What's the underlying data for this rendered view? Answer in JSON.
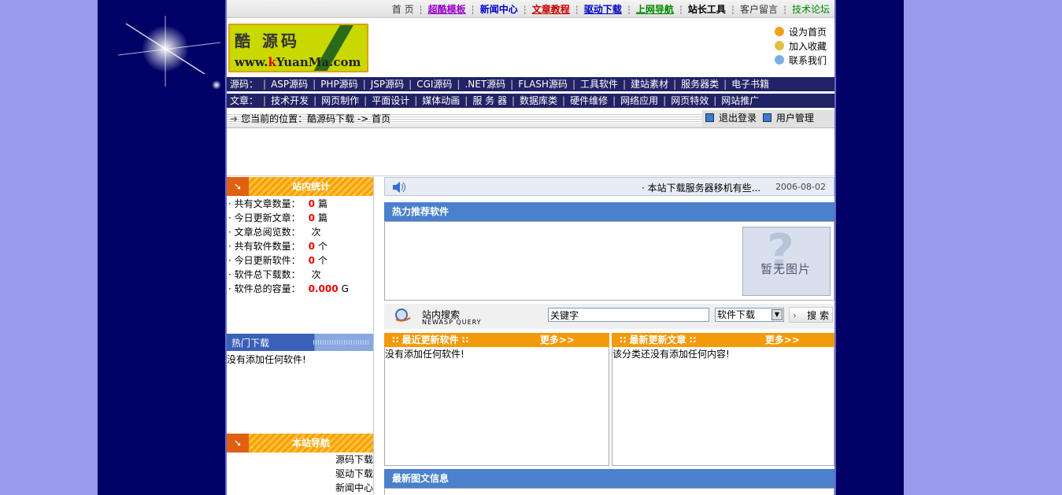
{
  "topnav": [
    {
      "label": "首 页",
      "color": "#333333",
      "bold": false,
      "underline": false
    },
    {
      "label": "超酷模板",
      "color": "#9900cc",
      "bold": true,
      "underline": true
    },
    {
      "label": "新闻中心",
      "color": "#0000cc",
      "bold": true,
      "underline": false
    },
    {
      "label": "文章教程",
      "color": "#cc0000",
      "bold": true,
      "underline": true
    },
    {
      "label": "驱动下载",
      "color": "#0000cc",
      "bold": true,
      "underline": true
    },
    {
      "label": "上网导航",
      "color": "#008800",
      "bold": true,
      "underline": true
    },
    {
      "label": "站长工具",
      "color": "#000000",
      "bold": true,
      "underline": false
    },
    {
      "label": "客户留言",
      "color": "#333333",
      "bold": false,
      "underline": false
    },
    {
      "label": "技术论坛",
      "color": "#008800",
      "bold": false,
      "underline": false
    }
  ],
  "logo": {
    "line1": "酷 源码",
    "line2_pre": "www.",
    "line2_red": "k",
    "line2_post": "YuanMa.com"
  },
  "quick_links": [
    {
      "label": "设为首页",
      "color": "#f0a020"
    },
    {
      "label": "加入收藏",
      "color": "#e0c040"
    },
    {
      "label": "联系我们",
      "color": "#7ab0e0"
    }
  ],
  "source_bar": {
    "title": "源码：",
    "items": [
      "ASP源码",
      "PHP源码",
      "JSP源码",
      "CGI源码",
      ".NET源码",
      "FLASH源码",
      "工具软件",
      "建站素材",
      "服务器类",
      "电子书籍"
    ]
  },
  "article_bar": {
    "title": "文章：",
    "items": [
      "技术开发",
      "网页制作",
      "平面设计",
      "媒体动画",
      "服 务 器",
      "数据库类",
      "硬件维修",
      "网络应用",
      "网页特效",
      "网站推广"
    ]
  },
  "location": {
    "text": "您当前的位置：酷源码下载 -> 首页",
    "logout": "退出登录",
    "user_admin": "用户管理"
  },
  "stats": {
    "title": "站内统计",
    "rows": [
      {
        "label": "· 共有文章数量：",
        "value": "0",
        "unit": "篇"
      },
      {
        "label": "· 今日更新文章：",
        "value": "0",
        "unit": "篇"
      },
      {
        "label": "· 文章总阅览数：",
        "value": "",
        "unit": "次"
      },
      {
        "label": "· 共有软件数量：",
        "value": "0",
        "unit": "个"
      },
      {
        "label": "· 今日更新软件：",
        "value": "0",
        "unit": "个"
      },
      {
        "label": "· 软件总下载数：",
        "value": "",
        "unit": "次"
      },
      {
        "label": "· 软件总的容量：",
        "value": "0.000",
        "unit": "G"
      }
    ]
  },
  "hot_downloads": {
    "title": "热门下载",
    "empty": "没有添加任何软件!"
  },
  "site_nav": {
    "title": "本站导航",
    "items": [
      "源码下载",
      "驱动下载",
      "新闻中心"
    ]
  },
  "news_ticker": {
    "text": "· 本站下载服务器移机有些...",
    "date": "2006-08-02"
  },
  "recommend": {
    "title": "热力推荐软件",
    "noimg": "暂无图片"
  },
  "search": {
    "title": "站内搜索",
    "subtitle": "NEWASP QUERY",
    "keyword": "关键字",
    "category": "软件下载",
    "button": "搜 索"
  },
  "latest_software": {
    "title": "∷ 最近更新软件 ∷",
    "more": "更多>>",
    "empty": "没有添加任何软件!"
  },
  "latest_articles": {
    "title": "∷ 最新更新文章 ∷",
    "more": "更多>>",
    "empty": "该分类还没有添加任何内容!"
  },
  "image_news": {
    "title": "最新图文信息"
  }
}
